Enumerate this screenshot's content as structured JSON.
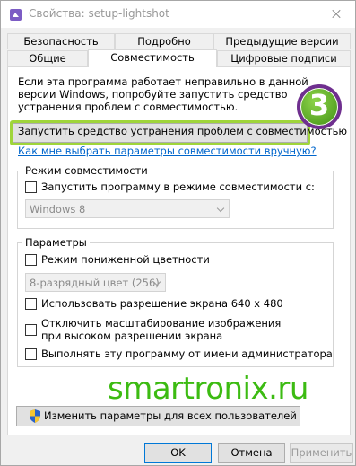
{
  "window": {
    "title": "Свойства: setup-lightshot"
  },
  "tabs": {
    "row1": [
      "Безопасность",
      "Подробно",
      "Предыдущие версии"
    ],
    "row2": [
      "Общие",
      "Совместимость",
      "Цифровые подписи"
    ],
    "active": "Совместимость"
  },
  "intro": {
    "text": "Если эта программа работает неправильно в данной версии Windows, попробуйте запустить средство устранения проблем с совместимостью."
  },
  "troubleshoot": {
    "label": "Запустить средство устранения проблем с совместимостью",
    "step_badge": "3"
  },
  "help_link": {
    "label": "Как мне выбрать параметры совместимости вручную?"
  },
  "compat_mode": {
    "title": "Режим совместимости",
    "checkbox_label": "Запустить программу в режиме совместимости с:",
    "checked": false,
    "selected_os": "Windows 8"
  },
  "settings": {
    "title": "Параметры",
    "reduced_color_label": "Режим пониженной цветности",
    "reduced_color_checked": false,
    "color_depth_value": "8-разрядный цвет (256)",
    "res640_label": "Использовать разрешение экрана 640 x 480",
    "res640_checked": false,
    "dpi_label": "Отключить масштабирование изображения при высоком разрешении экрана",
    "dpi_checked": false,
    "admin_label": "Выполнять эту программу от имени администратора",
    "admin_checked": false
  },
  "watermark": {
    "text": "smartronix.ru"
  },
  "all_users_button": {
    "label": "Изменить параметры для всех пользователей"
  },
  "buttons": {
    "ok": "OK",
    "cancel": "Отмена",
    "apply": "Применить"
  },
  "colors": {
    "link": "#0066cc",
    "highlight": "#9fd53a",
    "watermark": "#3cbb12",
    "badge_border": "#6f2f8f"
  }
}
